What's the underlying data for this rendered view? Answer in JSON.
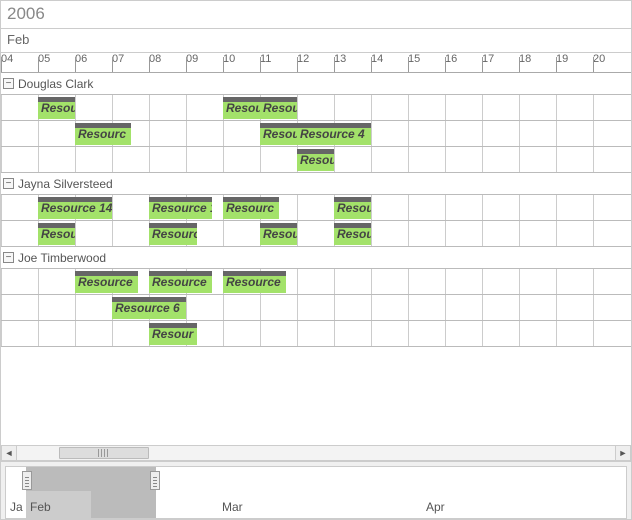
{
  "timeline": {
    "year": "2006",
    "month": "Feb",
    "days": [
      "04",
      "05",
      "06",
      "07",
      "08",
      "09",
      "10",
      "11",
      "12",
      "13",
      "14",
      "15",
      "16",
      "17",
      "18",
      "19",
      "20"
    ]
  },
  "groups": [
    {
      "name": "Douglas  Clark",
      "rows": [
        [
          {
            "start_idx": 1,
            "span": 1,
            "label": "Resourc"
          },
          {
            "start_idx": 6,
            "span": 1,
            "label": "Resou"
          },
          {
            "start_idx": 7,
            "span": 1,
            "label": "Resourc"
          }
        ],
        [
          {
            "start_idx": 2,
            "span": 1.5,
            "label": "Resourc"
          },
          {
            "start_idx": 7,
            "span": 1,
            "label": "Resou"
          },
          {
            "start_idx": 8,
            "span": 2,
            "label": "Resource 4"
          }
        ],
        [
          {
            "start_idx": 8,
            "span": 1,
            "label": "Resour"
          }
        ]
      ]
    },
    {
      "name": "Jayna  Silversteed",
      "rows": [
        [
          {
            "start_idx": 1,
            "span": 2,
            "label": "Resource 14"
          },
          {
            "start_idx": 4,
            "span": 1.7,
            "label": "Resource 1"
          },
          {
            "start_idx": 6,
            "span": 1.5,
            "label": "Resourc"
          },
          {
            "start_idx": 9,
            "span": 1,
            "label": "Resour"
          }
        ],
        [
          {
            "start_idx": 1,
            "span": 1,
            "label": "Resour"
          },
          {
            "start_idx": 4,
            "span": 1.3,
            "label": "Resourc"
          },
          {
            "start_idx": 7,
            "span": 1,
            "label": "Resou"
          },
          {
            "start_idx": 9,
            "span": 1,
            "label": "Resou"
          }
        ]
      ]
    },
    {
      "name": "Joe  Timberwood",
      "rows": [
        [
          {
            "start_idx": 2,
            "span": 1.7,
            "label": "Resource"
          },
          {
            "start_idx": 4,
            "span": 1.7,
            "label": "Resource"
          },
          {
            "start_idx": 6,
            "span": 1.7,
            "label": "Resource"
          }
        ],
        [
          {
            "start_idx": 3,
            "span": 2,
            "label": "Resource 6"
          }
        ],
        [
          {
            "start_idx": 4,
            "span": 1.3,
            "label": "Resour"
          }
        ]
      ]
    }
  ],
  "overview": {
    "labels": [
      "Ja",
      "Feb",
      "Mar",
      "Apr"
    ]
  },
  "collapse_glyph": "−"
}
